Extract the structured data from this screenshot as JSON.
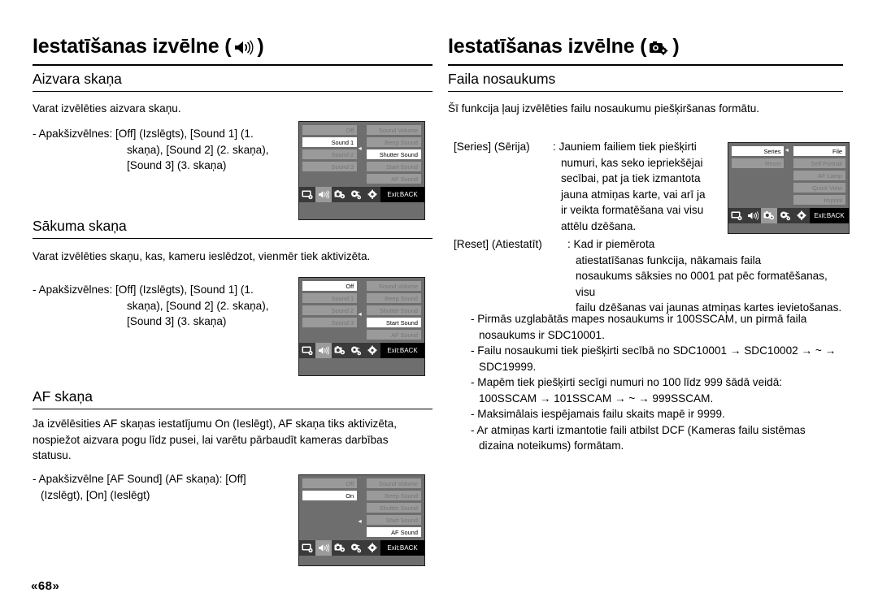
{
  "page_number": "«68»",
  "left_column": {
    "chapter_title_pre": "Iestatīšanas izvēlne (",
    "chapter_title_post": ")",
    "chapter_icon": "speaker-icon",
    "sections": [
      {
        "heading": "Aizvara skaņa",
        "intro": "Varat izvēlēties aizvara skaņu.",
        "bullet_lead": "- Apakšizvēlnes: [Off] (Izslēgts), [Sound 1] (1.",
        "bullet_l2": "skaņa), [Sound 2] (2. skaņa),",
        "bullet_l3": "[Sound 3] (3. skaņa)"
      },
      {
        "heading": "Sākuma skaņa",
        "intro": "Varat izvēlēties skaņu, kas, kameru ieslēdzot, vienmēr tiek aktivizēta.",
        "bullet_lead": "- Apakšizvēlnes: [Off] (Izslēgts), [Sound 1] (1.",
        "bullet_l2": "skaņa), [Sound 2] (2. skaņa),",
        "bullet_l3": "[Sound 3] (3. skaņa)"
      },
      {
        "heading": "AF skaņa",
        "intro_l1": "Ja izvēlēsities AF skaņas iestatījumu On (Ieslēgt), AF skaņa tiks aktivizēta,",
        "intro_l2": "nospiežot aizvara pogu līdz pusei, lai varētu pārbaudīt kameras darbības",
        "intro_l3": "statusu.",
        "bullet_lead": "- Apakšizvēlne [AF Sound] (AF skaņa): [Off]",
        "bullet_l2": "(Izslēgt), [On] (Ieslēgt)"
      }
    ]
  },
  "right_column": {
    "chapter_title_pre": "Iestatīšanas izvēlne (",
    "chapter_title_post": ")",
    "chapter_icon": "camera-setup-icon",
    "heading": "Faila nosaukums",
    "intro": "Šī funkcija ļauj izvēlēties failu nosaukumu piešķiršanas formātu.",
    "definitions": [
      {
        "term": "[Series] (Sērija)",
        "lines": [
          ": Jauniem failiem tiek piešķirti",
          "numuri, kas seko iepriekšējai",
          "secībai, pat ja tiek izmantota",
          "jauna atmiņas karte, vai arī ja",
          "ir veikta formatēšana vai visu",
          "attēlu dzēšana."
        ]
      },
      {
        "term": "[Reset] (Atiestatīt)",
        "lines": [
          ": Kad ir piemērota",
          "atiestatīšanas funkcija, nākamais faila",
          "nosaukums sāksies no 0001 pat pēc formatēšanas, visu",
          "failu dzēšanas vai jaunas atmiņas kartes ievietošanas."
        ]
      }
    ],
    "bullets": [
      [
        "- Pirmās uzglabātās mapes nosaukums ir 100SSCAM, un pirmā faila",
        "nosaukums ir SDC10001."
      ],
      [
        "- Failu nosaukumi tiek piešķirti secībā no SDC10001 → SDC10002 → ~ →",
        "SDC19999."
      ],
      [
        "- Mapēm tiek piešķirti secīgi numuri no 100 līdz 999 šādā veidā:",
        "100SSCAM → 101SSCAM → ~ → 999SSCAM."
      ],
      [
        "- Maksimālais iespējamais failu skaits mapē ir 9999."
      ],
      [
        "- Ar atmiņas karti izmantotie faili atbilst DCF (Kameras failu sistēmas",
        "dizaina noteikums) formātam."
      ]
    ]
  },
  "lcd_screens": {
    "shutter_sound": {
      "name": "shutter-sound-screen",
      "left_items": [
        {
          "label": "Off",
          "selected": false
        },
        {
          "label": "Sound 1",
          "selected": true
        },
        {
          "label": "Sound 2",
          "selected": false
        },
        {
          "label": "Sound 3",
          "selected": false
        },
        {
          "label": "",
          "selected": false,
          "blank": true
        }
      ],
      "right_items": [
        {
          "label": "Sound Volume",
          "selected": false
        },
        {
          "label": "Beep Sound",
          "selected": false
        },
        {
          "label": "Shutter Sound",
          "selected": true
        },
        {
          "label": "Start Sound",
          "selected": false
        },
        {
          "label": "AF Sound",
          "selected": false
        }
      ],
      "arrow_row": 3,
      "exit_label": "Exit:BACK",
      "active_tab": 1
    },
    "start_sound": {
      "name": "start-sound-screen",
      "left_items": [
        {
          "label": "Off",
          "selected": true
        },
        {
          "label": "Sound 1",
          "selected": false
        },
        {
          "label": "Sound 2",
          "selected": false
        },
        {
          "label": "Sound 3",
          "selected": false
        },
        {
          "label": "",
          "selected": false,
          "blank": true
        }
      ],
      "right_items": [
        {
          "label": "Sound Volume",
          "selected": false
        },
        {
          "label": "Beep Sound",
          "selected": false
        },
        {
          "label": "Shutter Sound",
          "selected": false
        },
        {
          "label": "Start Sound",
          "selected": true
        },
        {
          "label": "AF Sound",
          "selected": false
        }
      ],
      "arrow_row": 4,
      "exit_label": "Exit:BACK",
      "active_tab": 1
    },
    "af_sound": {
      "name": "af-sound-screen",
      "left_items": [
        {
          "label": "Off",
          "selected": false
        },
        {
          "label": "On",
          "selected": true
        },
        {
          "label": "",
          "selected": false,
          "blank": true
        },
        {
          "label": "",
          "selected": false,
          "blank": true
        },
        {
          "label": "",
          "selected": false,
          "blank": true
        }
      ],
      "right_items": [
        {
          "label": "Sound Volume",
          "selected": false
        },
        {
          "label": "Beep Sound",
          "selected": false
        },
        {
          "label": "Shutter Sound",
          "selected": false
        },
        {
          "label": "Start Sound",
          "selected": false
        },
        {
          "label": "AF Sound",
          "selected": true
        }
      ],
      "arrow_row": 5,
      "exit_label": "Exit:BACK",
      "active_tab": 1
    },
    "file_name": {
      "name": "file-name-screen",
      "left_items": [
        {
          "label": "Series",
          "selected": true
        },
        {
          "label": "Reset",
          "selected": false
        },
        {
          "label": "",
          "selected": false,
          "blank": true
        },
        {
          "label": "",
          "selected": false,
          "blank": true
        },
        {
          "label": "",
          "selected": false,
          "blank": true
        }
      ],
      "right_items": [
        {
          "label": "File",
          "selected": true
        },
        {
          "label": "Self Portrait",
          "selected": false
        },
        {
          "label": "AF Lamp",
          "selected": false
        },
        {
          "label": "Quick View",
          "selected": false
        },
        {
          "label": "Imprint",
          "selected": false
        }
      ],
      "arrow_row": 1,
      "exit_label": "Exit:BACK",
      "active_tab": 2
    }
  },
  "icon_bar": {
    "icons": [
      "display-setup-icon",
      "speaker-icon",
      "camera-setup-icon",
      "palette-icon",
      "gear-icon"
    ]
  },
  "colors": {
    "lcd_background": "#6e6e6e",
    "lcd_item": "#9a9a9a",
    "lcd_item_text": "#777777",
    "lcd_selected": "#ffffff",
    "lcd_bar": "#3a3a3a",
    "exit_bar": "#000000"
  }
}
